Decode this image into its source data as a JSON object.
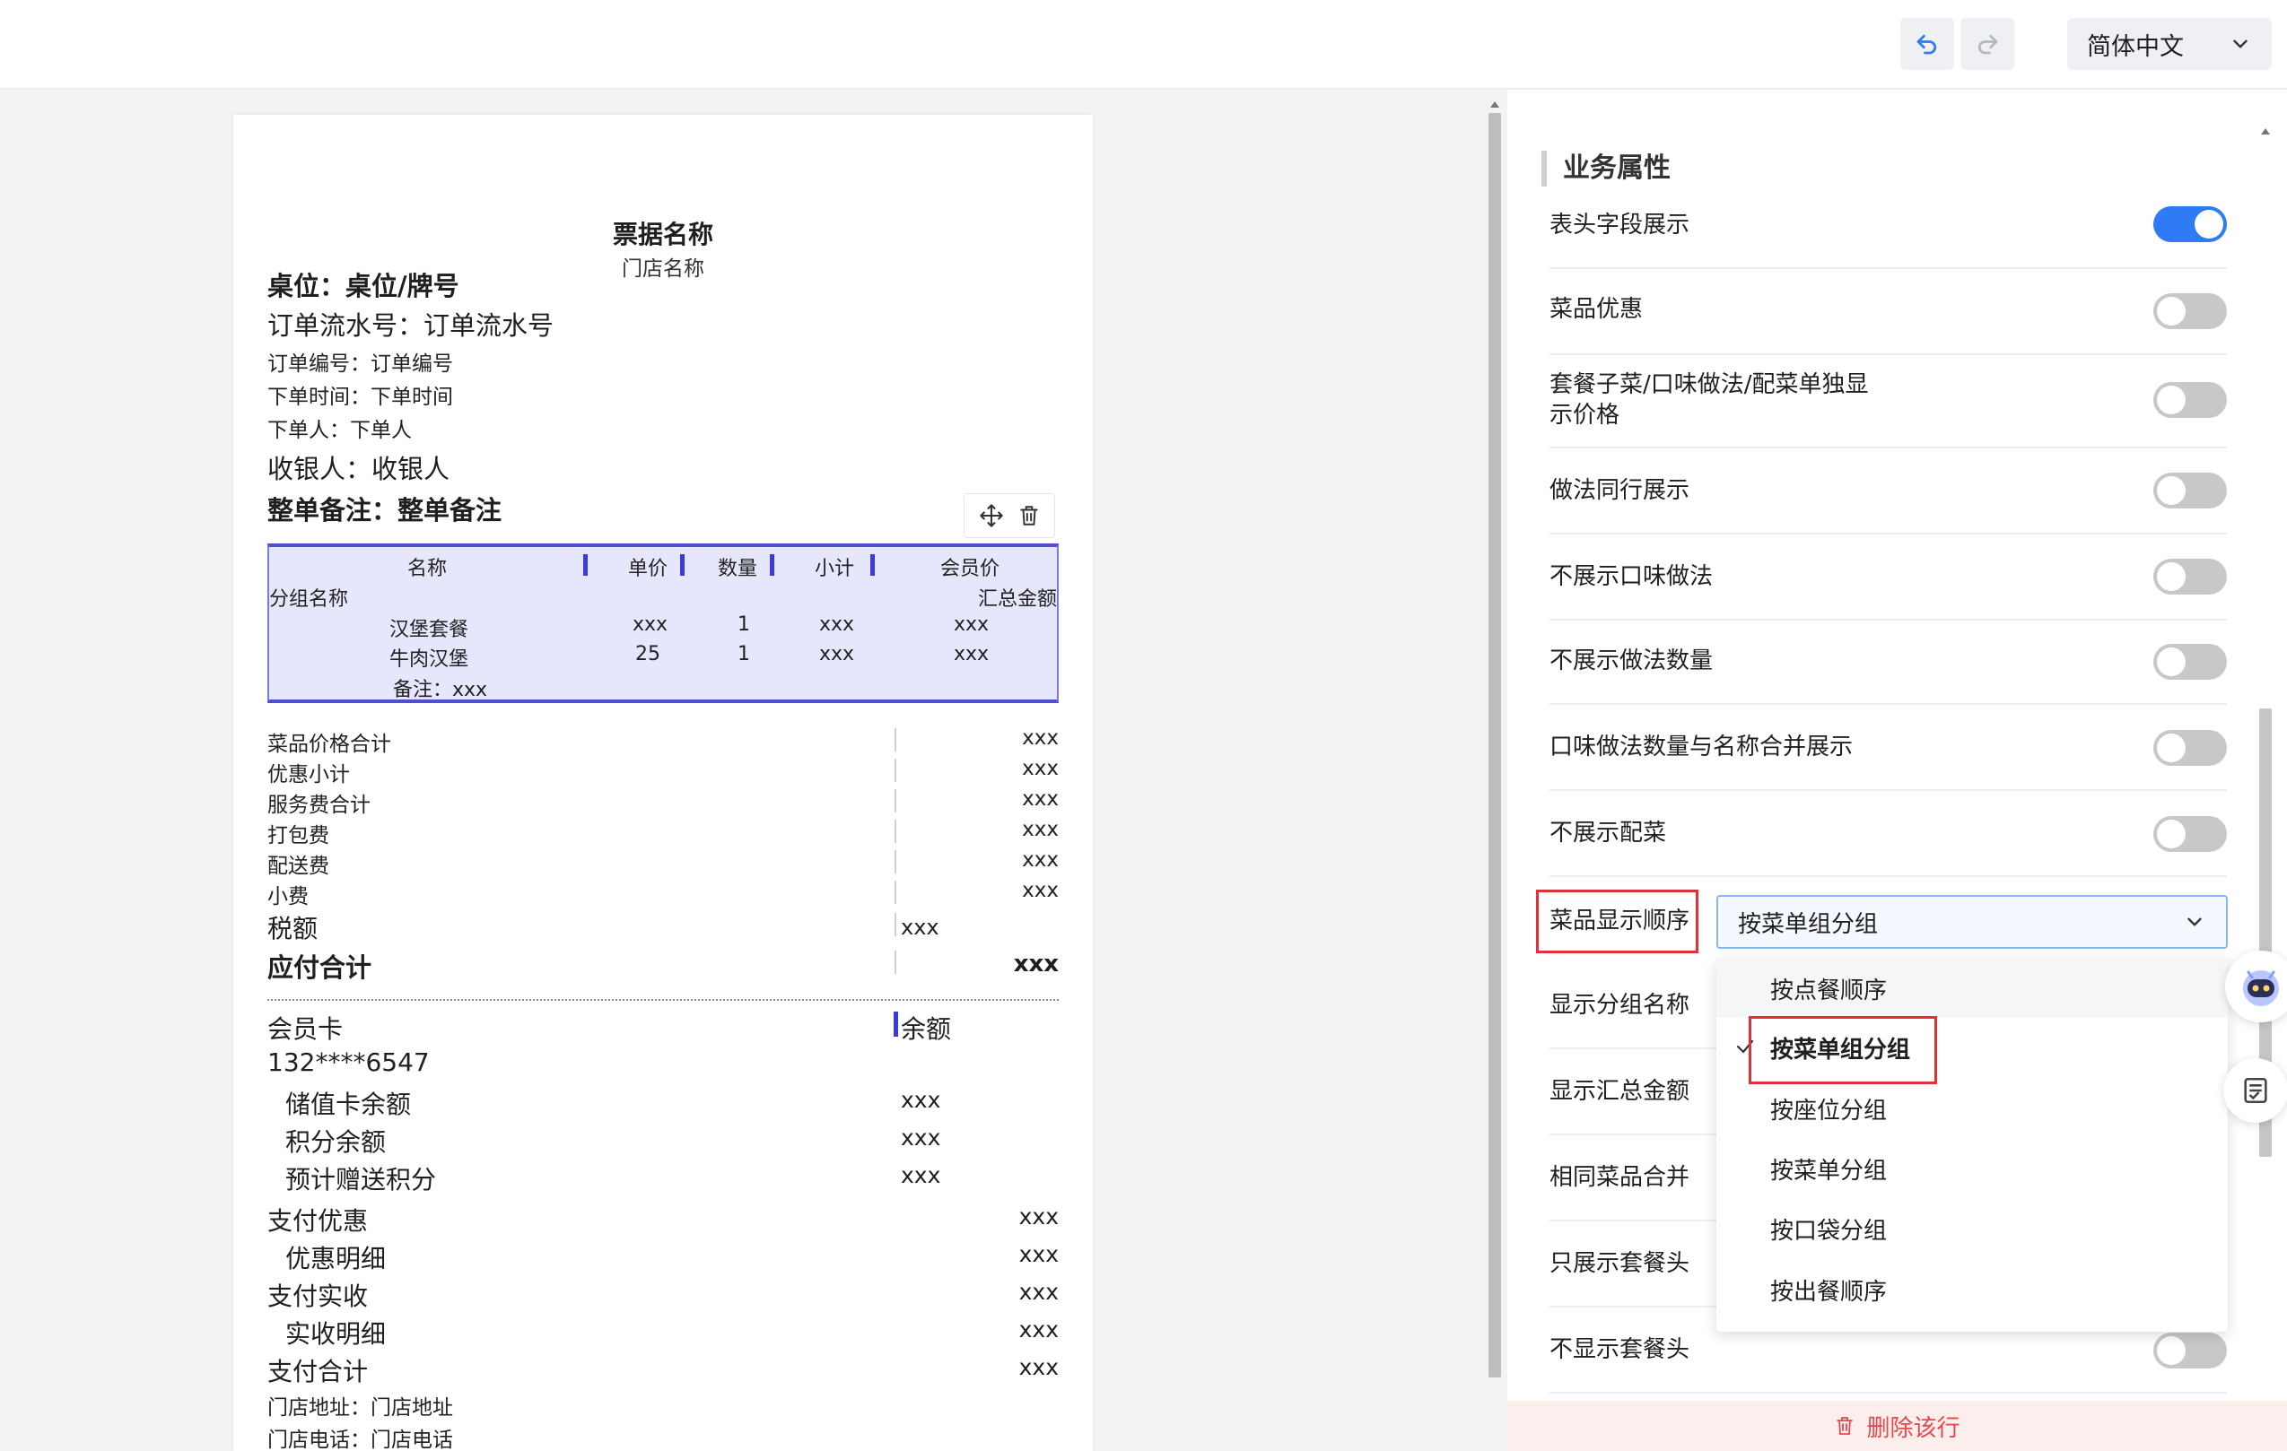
{
  "topbar": {
    "language": "简体中文"
  },
  "receipt": {
    "title": "票据名称",
    "store_name": "门店名称",
    "lines": {
      "table_no": "桌位：桌位/牌号",
      "serial_no": "订单流水号：订单流水号",
      "order_no": "订单编号：订单编号",
      "order_time": "下单时间：下单时间",
      "orderer": "下单人：下单人",
      "cashier": "收银人：收银人",
      "remark": "整单备注：整单备注"
    },
    "table": {
      "headers": [
        "名称",
        "单价",
        "数量",
        "小计",
        "会员价"
      ],
      "group_name": "分组名称",
      "group_total": "汇总金额",
      "rows": [
        {
          "name": "汉堡套餐",
          "price": "xxx",
          "qty": "1",
          "subtotal": "xxx",
          "member": "xxx"
        },
        {
          "name": "牛肉汉堡",
          "price": "25",
          "qty": "1",
          "subtotal": "xxx",
          "member": "xxx"
        }
      ],
      "note": "备注：xxx"
    },
    "summary": [
      {
        "label": "菜品价格合计",
        "value": "xxx"
      },
      {
        "label": "优惠小计",
        "value": "xxx"
      },
      {
        "label": "服务费合计",
        "value": "xxx"
      },
      {
        "label": "打包费",
        "value": "xxx"
      },
      {
        "label": "配送费",
        "value": "xxx"
      },
      {
        "label": "小费",
        "value": "xxx"
      }
    ],
    "tax_label": "税额",
    "tax_value": "xxx",
    "payable_label": "应付合计",
    "payable_value": "xxx",
    "member": {
      "card_label": "会员卡",
      "balance_label": "余额",
      "phone": "132****6547",
      "items": [
        {
          "label": "储值卡余额",
          "value": "xxx"
        },
        {
          "label": "积分余额",
          "value": "xxx"
        },
        {
          "label": "预计赠送积分",
          "value": "xxx"
        }
      ]
    },
    "payments": [
      {
        "label": "支付优惠",
        "value": "xxx",
        "indent": false
      },
      {
        "label": "优惠明细",
        "value": "xxx",
        "indent": true
      },
      {
        "label": "支付实收",
        "value": "xxx",
        "indent": false
      },
      {
        "label": "实收明细",
        "value": "xxx",
        "indent": true
      },
      {
        "label": "支付合计",
        "value": "xxx",
        "indent": false
      }
    ],
    "store_address": "门店地址：门店地址",
    "store_phone": "门店电话：门店电话"
  },
  "panel": {
    "section_title": "业务属性",
    "rows": [
      {
        "label": "表头字段展示",
        "toggle": true
      },
      {
        "label": "菜品优惠",
        "toggle": false
      },
      {
        "label": "套餐子菜/口味做法/配菜单独显",
        "label2": "示价格",
        "toggle": false
      },
      {
        "label": "做法同行展示",
        "toggle": false
      },
      {
        "label": "不展示口味做法",
        "toggle": false
      },
      {
        "label": "不展示做法数量",
        "toggle": false
      },
      {
        "label": "口味做法数量与名称合并展示",
        "toggle": false
      },
      {
        "label": "不展示配菜",
        "toggle": false
      }
    ],
    "order_label": "菜品显示顺序",
    "order_value": "按菜单组分组",
    "hidden_rows": [
      {
        "label": "显示分组名称"
      },
      {
        "label": "显示汇总金额"
      },
      {
        "label": "相同菜品合并"
      },
      {
        "label": "只展示套餐头"
      },
      {
        "label": "不显示套餐头",
        "toggle": false
      }
    ],
    "dropdown_options": [
      "按点餐顺序",
      "按菜单组分组",
      "按座位分组",
      "按菜单分组",
      "按口袋分组",
      "按出餐顺序"
    ],
    "dropdown_selected_index": 1,
    "delete_label": "删除该行"
  },
  "colors": {
    "accent": "#2f7bf5",
    "highlight": "#e0303a",
    "table_bg": "#e6e6fd",
    "danger": "#e5484d"
  }
}
